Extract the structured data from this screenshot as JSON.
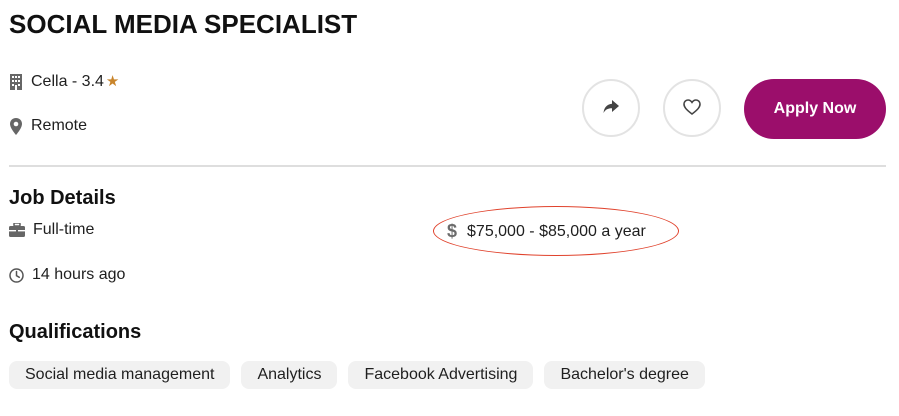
{
  "job": {
    "title": "SOCIAL MEDIA SPECIALIST",
    "company": "Cella - 3.4",
    "location": "Remote"
  },
  "actions": {
    "apply_label": "Apply Now"
  },
  "details": {
    "heading": "Job Details",
    "job_type": "Full-time",
    "salary": "$75,000 - $85,000 a year",
    "posted": "14 hours ago"
  },
  "qualifications": {
    "heading": "Qualifications",
    "tags": [
      "Social media management",
      "Analytics",
      "Facebook Advertising",
      "Bachelor's degree"
    ]
  },
  "icons": {
    "company": "building-icon",
    "rating": "star-icon",
    "location": "location-pin-icon",
    "share": "share-arrow-icon",
    "save": "heart-icon",
    "job_type": "briefcase-icon",
    "salary": "dollar-icon",
    "posted": "clock-icon"
  },
  "colors": {
    "accent": "#9b0e6b",
    "rating_star": "#c9852c",
    "annotation": "#e0422c",
    "tag_background": "#f1f1f1"
  }
}
